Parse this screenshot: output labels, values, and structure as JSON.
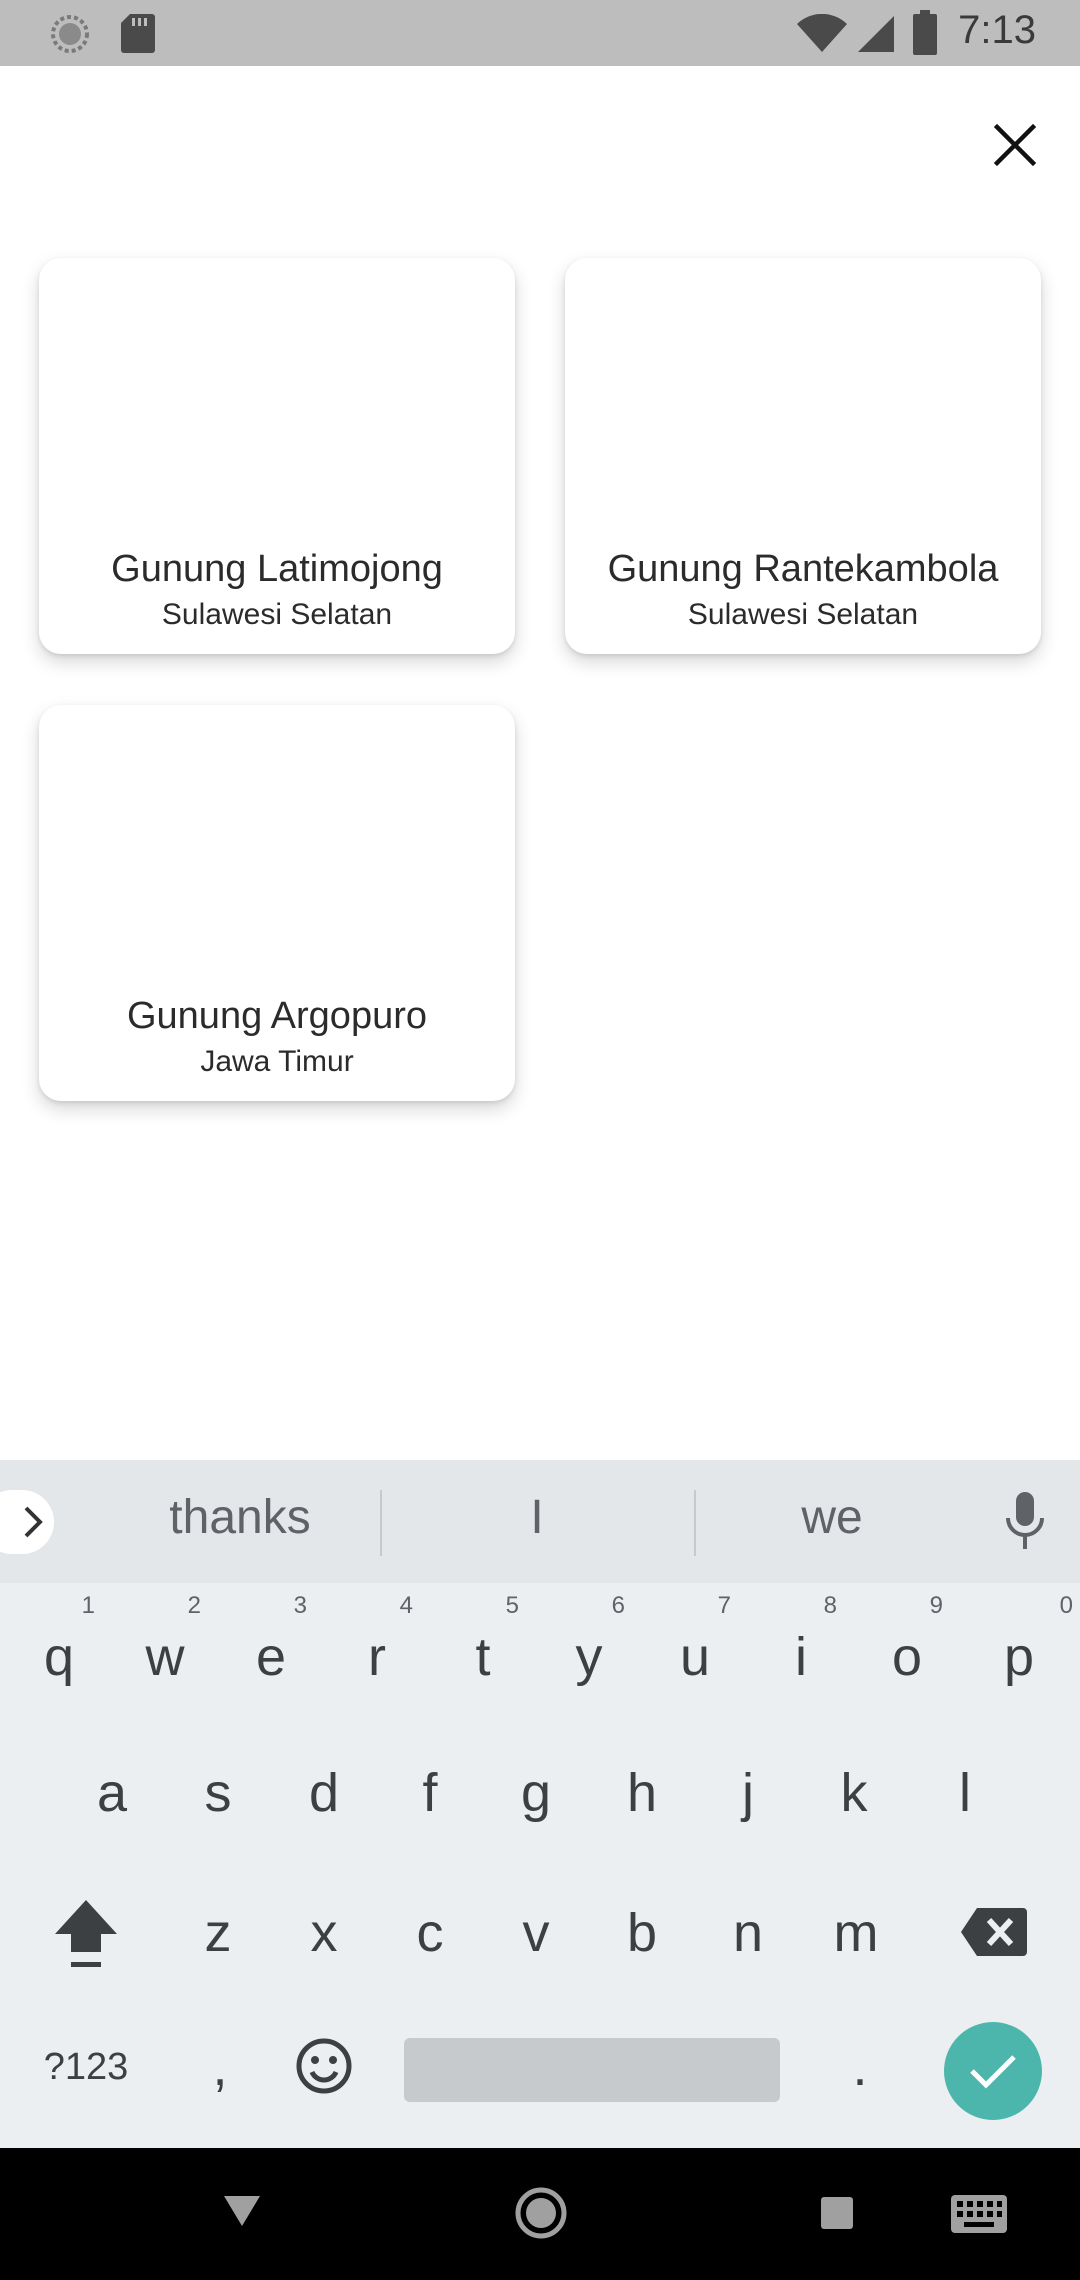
{
  "status_bar": {
    "time": "7:13"
  },
  "cards": [
    {
      "title": "Gunung Latimojong",
      "subtitle": "Sulawesi Selatan"
    },
    {
      "title": "Gunung Rantekambola",
      "subtitle": "Sulawesi Selatan"
    },
    {
      "title": "Gunung Argopuro",
      "subtitle": "Jawa Timur"
    }
  ],
  "keyboard": {
    "suggestions": [
      "thanks",
      "I",
      "we"
    ],
    "row1": [
      {
        "key": "q",
        "hint": "1"
      },
      {
        "key": "w",
        "hint": "2"
      },
      {
        "key": "e",
        "hint": "3"
      },
      {
        "key": "r",
        "hint": "4"
      },
      {
        "key": "t",
        "hint": "5"
      },
      {
        "key": "y",
        "hint": "6"
      },
      {
        "key": "u",
        "hint": "7"
      },
      {
        "key": "i",
        "hint": "8"
      },
      {
        "key": "o",
        "hint": "9"
      },
      {
        "key": "p",
        "hint": "0"
      }
    ],
    "row2": [
      "a",
      "s",
      "d",
      "f",
      "g",
      "h",
      "j",
      "k",
      "l"
    ],
    "row3": [
      "z",
      "x",
      "c",
      "v",
      "b",
      "n",
      "m"
    ],
    "symbols_label": "?123",
    "comma": ",",
    "period": "."
  },
  "colors": {
    "status_bar": "#bdbdbd",
    "keyboard_bg": "#eceff1",
    "enter_key": "#4db6ac",
    "nav_bar": "#000000"
  }
}
